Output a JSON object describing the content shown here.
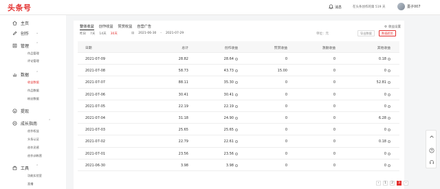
{
  "header": {
    "logo": "头条号",
    "message_label": "消息",
    "days_text": "在头条创作的第 519 天",
    "username": "墨子007"
  },
  "sidebar": {
    "home": "主页",
    "create": "创作",
    "manage": "管理",
    "manage_items": [
      "作品管理",
      "评论管理"
    ],
    "data": "数据",
    "data_items": [
      "收益数据",
      "作品数据",
      "粉丝数据"
    ],
    "withdraw": "提现",
    "growth": "成长指南",
    "growth_items": [
      "创作权益",
      "头条认证",
      "创作灵感",
      "创作训练营"
    ],
    "tools": "工具",
    "tools_items": [
      "功能实验室",
      "直播"
    ]
  },
  "main": {
    "tabs": [
      "整体收益",
      "创作收益",
      "赞赏收益",
      "自营广告"
    ],
    "income_settings": "收益设置",
    "ranges": [
      "昨日",
      "7天",
      "14天",
      "30天"
    ],
    "date_start": "2021-06-30",
    "date_sep": "-",
    "date_end": "2021-07-29",
    "unit_label": "单位：元",
    "export_label": "导出数据",
    "filter_label": "数据趋势",
    "columns": [
      "日期",
      "总计",
      "创作收益",
      "赞赏收益",
      "激励收益",
      "其他收益"
    ],
    "rows": [
      {
        "date": "2021-07-09",
        "total": "28.82",
        "create": "28.64",
        "reward": "0",
        "welfare": "0",
        "other": "0.18"
      },
      {
        "date": "2021-07-08",
        "total": "58.73",
        "create": "43.73",
        "reward": "15.00",
        "welfare": "0",
        "other": "0"
      },
      {
        "date": "2021-07-07",
        "total": "88.11",
        "create": "35.30",
        "reward": "0",
        "welfare": "0",
        "other": "52.81"
      },
      {
        "date": "2021-07-06",
        "total": "30.41",
        "create": "30.41",
        "reward": "0",
        "welfare": "0",
        "other": "0"
      },
      {
        "date": "2021-07-05",
        "total": "22.19",
        "create": "22.19",
        "reward": "0",
        "welfare": "0",
        "other": "0"
      },
      {
        "date": "2021-07-04",
        "total": "31.18",
        "create": "24.90",
        "reward": "0",
        "welfare": "0",
        "other": "6.28"
      },
      {
        "date": "2021-07-03",
        "total": "25.65",
        "create": "25.65",
        "reward": "0",
        "welfare": "0",
        "other": "0"
      },
      {
        "date": "2021-07-02",
        "total": "22.79",
        "create": "22.61",
        "reward": "0",
        "welfare": "0",
        "other": "0.18"
      },
      {
        "date": "2021-07-01",
        "total": "23.56",
        "create": "23.56",
        "reward": "0",
        "welfare": "0",
        "other": "0"
      },
      {
        "date": "2021-06-30",
        "total": "3.98",
        "create": "3.98",
        "reward": "0",
        "welfare": "0",
        "other": "0"
      }
    ]
  },
  "pagination": {
    "prev": "‹",
    "pages": [
      "1",
      "2",
      "3"
    ],
    "next": "›"
  },
  "colors": {
    "brand": "#e3302f",
    "background": "#f4f5f6"
  }
}
